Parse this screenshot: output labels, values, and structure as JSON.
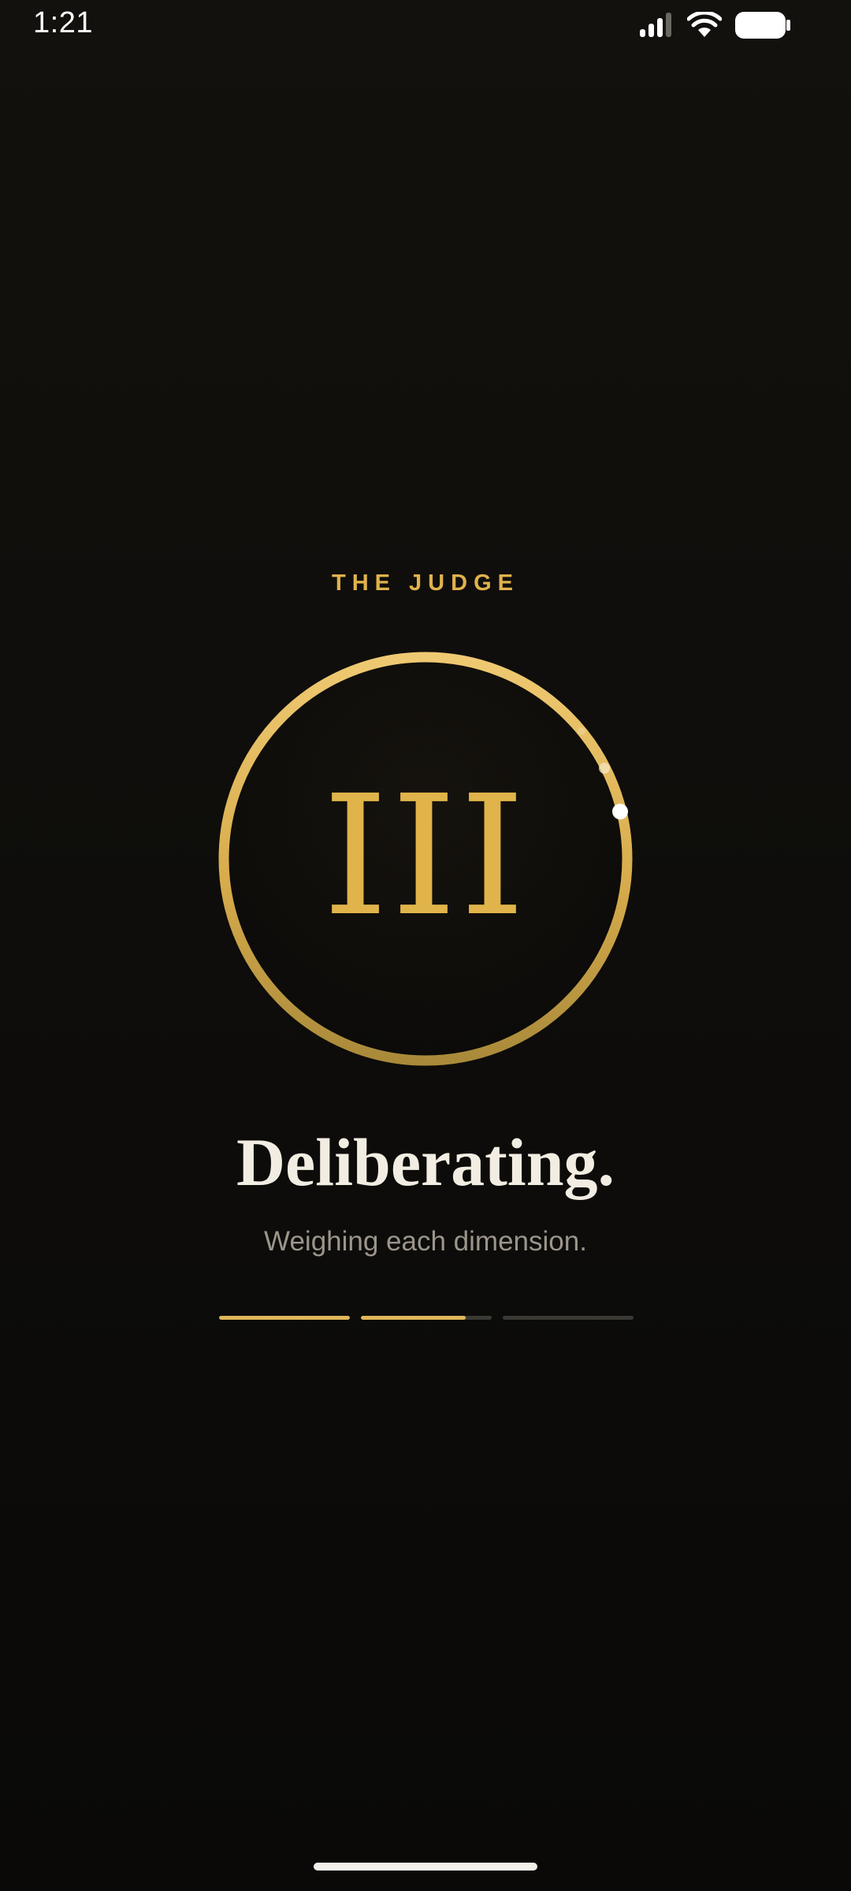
{
  "status_bar": {
    "time": "1:21",
    "icons": [
      "signal-icon",
      "wifi-icon",
      "battery-icon"
    ]
  },
  "loading": {
    "overline": "THE JUDGE",
    "numeral": "III",
    "title": "Deliberating.",
    "subtitle": "Weighing each dimension.",
    "progress_segments": [
      1.0,
      0.8,
      0.0
    ]
  },
  "colors": {
    "accent_gold": "#e0b44a",
    "background": "#0e0d0b",
    "title_text": "#f2ede2",
    "subtitle_text": "#9b958b"
  }
}
